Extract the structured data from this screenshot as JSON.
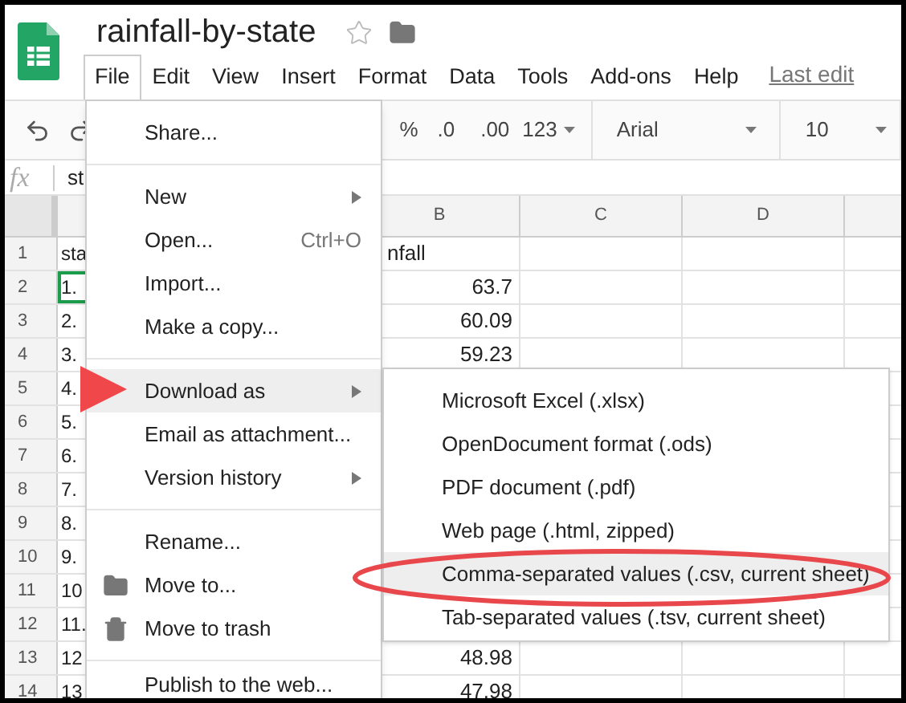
{
  "document": {
    "title": "rainfall-by-state",
    "starred": false
  },
  "menubar": [
    {
      "label": "File",
      "selected": true
    },
    {
      "label": "Edit",
      "selected": false
    },
    {
      "label": "View",
      "selected": false
    },
    {
      "label": "Insert",
      "selected": false
    },
    {
      "label": "Format",
      "selected": false
    },
    {
      "label": "Data",
      "selected": false
    },
    {
      "label": "Tools",
      "selected": false
    },
    {
      "label": "Add-ons",
      "selected": false
    },
    {
      "label": "Help",
      "selected": false
    }
  ],
  "last_edit": "Last edit",
  "toolbar": {
    "percent": "%",
    "decrease_decimals": ".0",
    "increase_decimals": ".00",
    "number_format": "123",
    "font": "Arial",
    "font_size": "10"
  },
  "formula_bar": {
    "label": "fx",
    "value": "st"
  },
  "columns": [
    "B",
    "C",
    "D"
  ],
  "rows": [
    {
      "number": "1",
      "a": "sta",
      "b": "nfall",
      "selected": false
    },
    {
      "number": "2",
      "a": "1.",
      "b": "63.7",
      "selected": true
    },
    {
      "number": "3",
      "a": "2.",
      "b": "60.09",
      "selected": false
    },
    {
      "number": "4",
      "a": "3.",
      "b": "59.23",
      "selected": false
    },
    {
      "number": "5",
      "a": "4.",
      "selected": false
    },
    {
      "number": "6",
      "a": "5.",
      "selected": false
    },
    {
      "number": "7",
      "a": "6.",
      "selected": false
    },
    {
      "number": "8",
      "a": "7.",
      "selected": false
    },
    {
      "number": "9",
      "a": "8.",
      "selected": false
    },
    {
      "number": "10",
      "a": "9.",
      "selected": false
    },
    {
      "number": "11",
      "a": "10",
      "selected": false
    },
    {
      "number": "12",
      "a": "11.",
      "selected": false
    },
    {
      "number": "13",
      "a": "12",
      "b": "48.98",
      "selected": false
    },
    {
      "number": "14",
      "a": "13",
      "b": "47.98",
      "selected": false
    }
  ],
  "file_menu": [
    {
      "kind": "item",
      "label": "Share...",
      "submenu": false,
      "selected": false
    },
    {
      "kind": "divider"
    },
    {
      "kind": "item",
      "label": "New",
      "submenu": true,
      "selected": false
    },
    {
      "kind": "item",
      "label": "Open...",
      "shortcut": "Ctrl+O",
      "submenu": false,
      "selected": false
    },
    {
      "kind": "item",
      "label": "Import...",
      "submenu": false,
      "selected": false
    },
    {
      "kind": "item",
      "label": "Make a copy...",
      "submenu": false,
      "selected": false
    },
    {
      "kind": "divider"
    },
    {
      "kind": "item",
      "label": "Download as",
      "submenu": true,
      "selected": true
    },
    {
      "kind": "item",
      "label": "Email as attachment...",
      "submenu": false,
      "selected": false
    },
    {
      "kind": "item",
      "label": "Version history",
      "submenu": true,
      "selected": false
    },
    {
      "kind": "divider"
    },
    {
      "kind": "item",
      "label": "Rename...",
      "submenu": false,
      "selected": false
    },
    {
      "kind": "folder",
      "label": "Move to...",
      "submenu": false,
      "selected": false
    },
    {
      "kind": "trash",
      "label": "Move to trash",
      "submenu": false,
      "selected": false
    },
    {
      "kind": "divider"
    },
    {
      "kind": "item",
      "label": "Publish to the web...",
      "submenu": false,
      "selected": false
    }
  ],
  "download_submenu": [
    {
      "label": "Microsoft Excel (.xlsx)",
      "selected": false
    },
    {
      "label": "OpenDocument format (.ods)",
      "selected": false
    },
    {
      "label": "PDF document (.pdf)",
      "selected": false
    },
    {
      "label": "Web page (.html, zipped)",
      "selected": false
    },
    {
      "label": "Comma-separated values (.csv, current sheet)",
      "selected": true
    },
    {
      "label": "Tab-separated values (.tsv, current sheet)",
      "selected": false
    }
  ]
}
